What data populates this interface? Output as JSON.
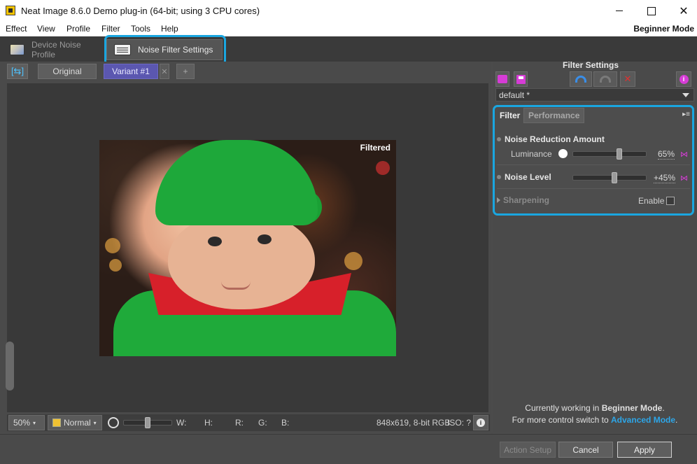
{
  "window": {
    "title": "Neat Image 8.6.0 Demo plug-in (64-bit; using 3 CPU cores)"
  },
  "menu": {
    "items": [
      "Effect",
      "View",
      "Profile",
      "Filter",
      "Tools",
      "Help"
    ],
    "mode": "Beginner Mode"
  },
  "tabs": {
    "device": "Device Noise Profile",
    "filter": "Noise Filter Settings"
  },
  "viewer": {
    "original_label": "Original",
    "variant_label": "Variant #1",
    "variant_close": "✕",
    "add_variant": "+",
    "photo_label": "Filtered"
  },
  "status": {
    "zoom": "50%",
    "view_mode": "Normal",
    "w_label": "W:",
    "h_label": "H:",
    "r_label": "R:",
    "g_label": "G:",
    "b_label": "B:",
    "image_info": "848x619, 8-bit RGB",
    "iso": "ISO: ?",
    "brightness_level": 0.5
  },
  "filter_settings": {
    "title": "Filter Settings",
    "preset": "default *",
    "subtabs": {
      "filter": "Filter",
      "performance": "Performance"
    },
    "noise_reduction": {
      "heading": "Noise Reduction Amount",
      "luminance_label": "Luminance",
      "luminance_value": "65%",
      "luminance_level": 0.65
    },
    "noise_level": {
      "heading": "Noise Level",
      "value": "+45%",
      "level": 0.57
    },
    "sharpening": {
      "heading": "Sharpening",
      "enable_label": "Enable"
    },
    "note_line1_prefix": "Currently working in",
    "note_line1_mode": "Beginner Mode",
    "note_line1_suffix": ".",
    "note_line2_prefix": "For more control switch to",
    "note_line2_link": "Advanced Mode",
    "note_line2_suffix": "."
  },
  "footer": {
    "action_setup": "Action Setup",
    "cancel": "Cancel",
    "apply": "Apply"
  },
  "colors": {
    "accent_highlight": "#1aa6e0",
    "variant_active": "#5b57b0",
    "link": "#2da6e8"
  }
}
